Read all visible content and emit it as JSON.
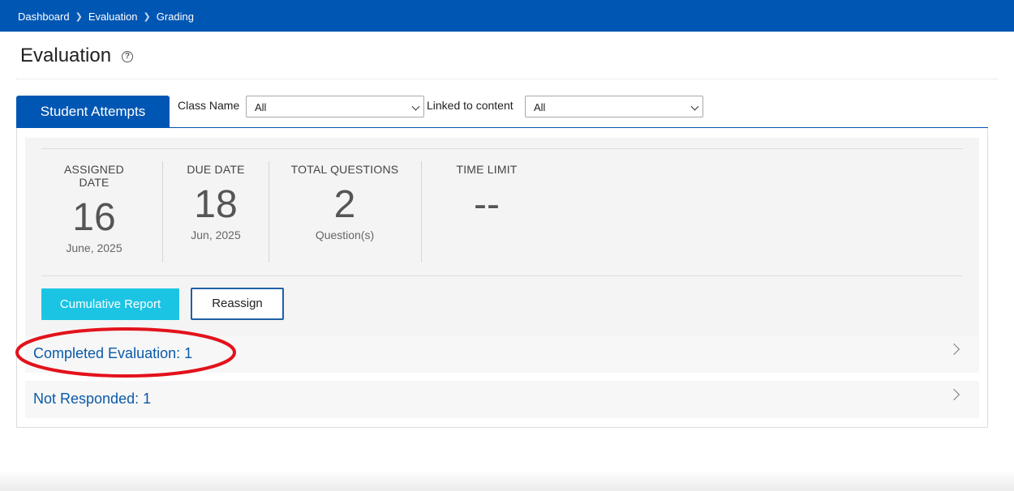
{
  "breadcrumb": [
    "Dashboard",
    "Evaluation",
    "Grading"
  ],
  "page": {
    "title": "Evaluation",
    "help_icon": "question-circle-icon"
  },
  "tabs": [
    {
      "label": "Student Attempts",
      "active": true
    }
  ],
  "filters": {
    "class_name": {
      "label": "Class Name",
      "value": "All"
    },
    "linked_content": {
      "label": "Linked to content",
      "value": "All"
    }
  },
  "stats": [
    {
      "label": "ASSIGNED DATE",
      "value": "16",
      "sub": "June, 2025"
    },
    {
      "label": "DUE DATE",
      "value": "18",
      "sub": "Jun, 2025"
    },
    {
      "label": "TOTAL QUESTIONS",
      "value": "2",
      "sub": "Question(s)"
    },
    {
      "label": "TIME LIMIT",
      "value": "--",
      "sub": ""
    }
  ],
  "buttons": {
    "cumulative_report": "Cumulative Report",
    "reassign": "Reassign"
  },
  "sections": [
    {
      "label": "Completed Evaluation: 1"
    },
    {
      "label": "Not Responded: 1"
    }
  ],
  "colors": {
    "primary": "#0056b3",
    "accent_cyan": "#1cc4e4",
    "link": "#0a5aa8",
    "annotation_red": "#e3121b"
  }
}
